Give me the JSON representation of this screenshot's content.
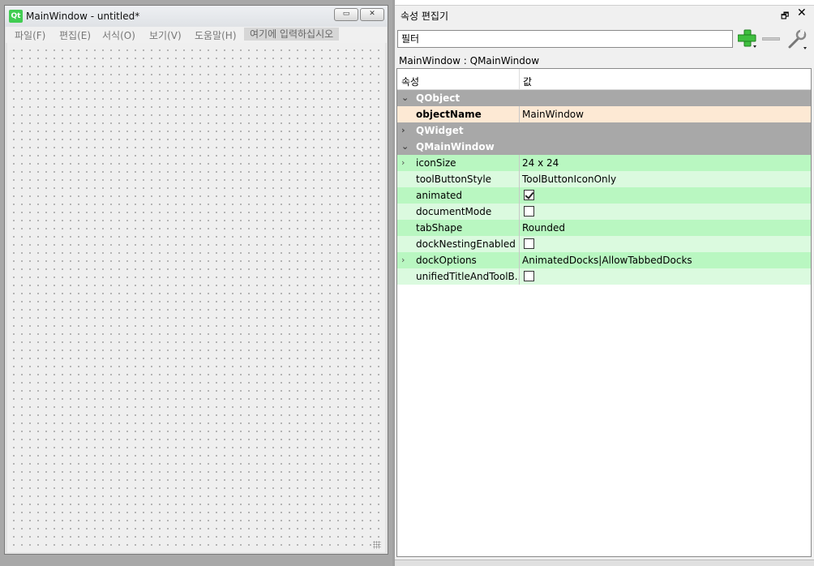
{
  "form_window": {
    "title": "MainWindow - untitled*",
    "logo_text": "Qt",
    "menu": [
      "파일(F)",
      "편집(E)",
      "서식(O)",
      "보기(V)",
      "도움말(H)"
    ],
    "menu_placeholder": "여기에 입력하십시오"
  },
  "property_editor": {
    "title": "속성 편집기",
    "filter_placeholder": "필터",
    "object_label": "MainWindow : QMainWindow",
    "header": {
      "property": "속성",
      "value": "값"
    },
    "rows": [
      {
        "type": "group",
        "name": "QObject",
        "expanded": true
      },
      {
        "type": "prop",
        "name": "objectName",
        "value": "MainWindow",
        "style": "orange"
      },
      {
        "type": "group",
        "name": "QWidget",
        "expanded": false
      },
      {
        "type": "group",
        "name": "QMainWindow",
        "expanded": true
      },
      {
        "type": "prop",
        "name": "iconSize",
        "value": "24 x 24",
        "expandable": true,
        "style": "green"
      },
      {
        "type": "prop",
        "name": "toolButtonStyle",
        "value": "ToolButtonIconOnly",
        "style": "green-light"
      },
      {
        "type": "prop",
        "name": "animated",
        "checkbox": true,
        "checked": true,
        "style": "green"
      },
      {
        "type": "prop",
        "name": "documentMode",
        "checkbox": true,
        "checked": false,
        "style": "green-light"
      },
      {
        "type": "prop",
        "name": "tabShape",
        "value": "Rounded",
        "style": "green"
      },
      {
        "type": "prop",
        "name": "dockNestingEnabled",
        "checkbox": true,
        "checked": false,
        "style": "green-light"
      },
      {
        "type": "prop",
        "name": "dockOptions",
        "value": "AnimatedDocks|AllowTabbedDocks",
        "expandable": true,
        "style": "green"
      },
      {
        "type": "prop",
        "name": "unifiedTitleAndToolB...",
        "checkbox": true,
        "checked": false,
        "style": "green-light"
      }
    ]
  },
  "colors": {
    "group_bg": "#a8a8a8",
    "green_row": "#b9f7c1",
    "green_row_light": "#dbfadf",
    "changed_row": "#fde9d4",
    "qt_logo": "#41cd52"
  },
  "icons": [
    "qt-logo-icon",
    "minimize-icon",
    "close-icon",
    "float-icon",
    "add-icon",
    "remove-icon",
    "configure-icon",
    "expand-arrow-icon",
    "collapse-arrow-icon",
    "checkbox-icon"
  ]
}
